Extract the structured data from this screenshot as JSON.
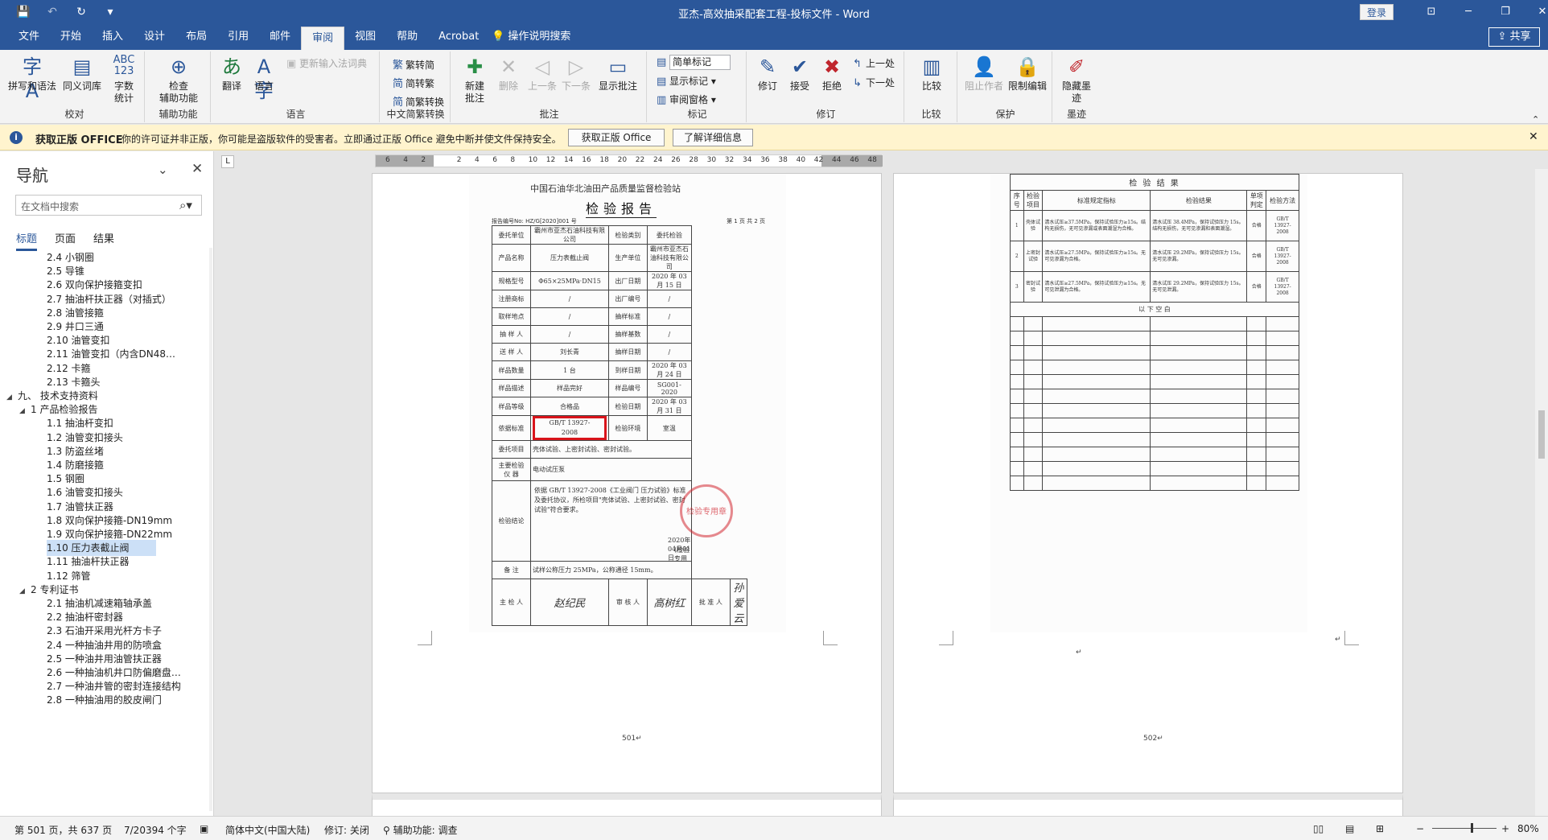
{
  "title_bar": {
    "title": "亚杰-高效抽采配套工程-投标文件  -  Word",
    "login": "登录",
    "qat": {
      "save": "💾",
      "undo": "↶",
      "redo": "↷",
      "refresh": "↻",
      "more": "▾"
    },
    "win": {
      "ribbon_opts": "⊡",
      "minimize": "─",
      "restore": "❐",
      "close": "✕"
    }
  },
  "tabs": [
    "文件",
    "开始",
    "插入",
    "设计",
    "布局",
    "引用",
    "邮件",
    "审阅",
    "视图",
    "帮助",
    "Acrobat"
  ],
  "tell_me": "操作说明搜索",
  "share": "共享",
  "ribbon": {
    "proofing": {
      "label": "校对",
      "spell": "拼写和语法",
      "thesaurus": "同义词库",
      "wordcount": "字数\n统计"
    },
    "accessibility": {
      "label": "辅助功能",
      "check": "检查\n辅助功能"
    },
    "language": {
      "label": "语言",
      "translate": "翻译",
      "language": "语言",
      "update_ime": "更新输入法词典"
    },
    "chinese": {
      "label": "中文简繁转换",
      "to_trad": "繁转简",
      "to_simp": "简转繁",
      "convert": "简繁转换"
    },
    "comments": {
      "label": "批注",
      "new": "新建\n批注",
      "delete": "删除",
      "prev": "上一条",
      "next": "下一条",
      "show": "显示批注"
    },
    "tracking": {
      "label": "标记",
      "markup_select": "简单标记",
      "show_markup": "显示标记",
      "review_pane": "审阅窗格"
    },
    "changes": {
      "label": "修订",
      "track": "修订",
      "accept": "接受",
      "reject": "拒绝",
      "prev": "上一处",
      "next": "下一处"
    },
    "compare": {
      "label": "比较",
      "compare": "比较"
    },
    "protect": {
      "label": "保护",
      "block": "阻止作者",
      "restrict": "限制编辑"
    },
    "ink": {
      "label": "墨迹",
      "hide": "隐藏墨\n迹"
    }
  },
  "message_bar": {
    "icon": "i",
    "title": "获取正版 OFFICE",
    "text": "你的许可证并非正版，你可能是盗版软件的受害者。立即通过正版 Office 避免中断并使文件保持安全。",
    "btn1": "获取正版 Office",
    "btn2": "了解详细信息",
    "close": "✕"
  },
  "nav": {
    "title": "导航",
    "search_placeholder": "在文档中搜索",
    "tabs": [
      "标题",
      "页面",
      "结果"
    ],
    "items": [
      {
        "text": "2.4 小钢圈",
        "level": 3
      },
      {
        "text": "2.5 导锥",
        "level": 3
      },
      {
        "text": "2.6 双向保护接箍变扣",
        "level": 3
      },
      {
        "text": "2.7 抽油杆扶正器（对插式）",
        "level": 3
      },
      {
        "text": "2.8 油管接箍",
        "level": 3
      },
      {
        "text": "2.9 井口三通",
        "level": 3
      },
      {
        "text": "2.10 油管变扣",
        "level": 3
      },
      {
        "text": "2.11 油管变扣（内含DN48…",
        "level": 3
      },
      {
        "text": "2.12 卡箍",
        "level": 3
      },
      {
        "text": "2.13 卡箍头",
        "level": 3
      },
      {
        "text": "九、 技术支持资料",
        "level": 1,
        "toggle": "◢"
      },
      {
        "text": "1 产品检验报告",
        "level": 2,
        "toggle": "◢"
      },
      {
        "text": "1.1 抽油杆变扣",
        "level": 3
      },
      {
        "text": "1.2 油管变扣接头",
        "level": 3
      },
      {
        "text": "1.3 防盗丝堵",
        "level": 3
      },
      {
        "text": "1.4 防磨接箍",
        "level": 3
      },
      {
        "text": "1.5 钢圈",
        "level": 3
      },
      {
        "text": "1.6 油管变扣接头",
        "level": 3
      },
      {
        "text": "1.7 油管扶正器",
        "level": 3
      },
      {
        "text": "1.8 双向保护接箍-DN19mm",
        "level": 3
      },
      {
        "text": "1.9 双向保护接箍-DN22mm",
        "level": 3
      },
      {
        "text": "1.10 压力表截止阀",
        "level": 3,
        "selected": true
      },
      {
        "text": "1.11 抽油杆扶正器",
        "level": 3
      },
      {
        "text": "1.12 筛管",
        "level": 3
      },
      {
        "text": "2 专利证书",
        "level": 2,
        "toggle": "◢"
      },
      {
        "text": "2.1 抽油机减速箱轴承盖",
        "level": 3
      },
      {
        "text": "2.2 抽油杆密封器",
        "level": 3
      },
      {
        "text": "2.3 石油开采用光杆方卡子",
        "level": 3
      },
      {
        "text": "2.4 一种抽油井用的防喷盒",
        "level": 3
      },
      {
        "text": "2.5 一种油井用油管扶正器",
        "level": 3
      },
      {
        "text": "2.6 一种抽油机井口防偏磨盘…",
        "level": 3
      },
      {
        "text": "2.7 一种油井管的密封连接结构",
        "level": 3
      },
      {
        "text": "2.8 一种抽油用的胶皮闸门",
        "level": 3
      }
    ]
  },
  "ruler": {
    "ticks": [
      "6",
      "4",
      "2",
      "",
      "2",
      "4",
      "6",
      "8",
      "10",
      "12",
      "14",
      "16",
      "18",
      "20",
      "22",
      "24",
      "26",
      "28",
      "30",
      "32",
      "34",
      "36",
      "38",
      "40",
      "42",
      "44",
      "46",
      "48"
    ],
    "corner": "L"
  },
  "page1": {
    "number": "501↵",
    "institute": "中国石油华北油田产品质量监督检验站",
    "report_title": "检验报告",
    "report_no": "报告编号No: HZ/G[2020]001 号",
    "page_of": "第 1 页 共 2 页",
    "rows": [
      [
        "委托单位",
        "霸州市亚杰石油科技有限公司",
        "检验类别",
        "委托检验"
      ],
      [
        "产品名称",
        "压力表截止阀",
        "生产单位",
        "霸州市亚杰石油科技有限公司"
      ],
      [
        "规格型号",
        "Φ65×25MPa·DN15",
        "出厂日期",
        "2020 年 03 月 15 日"
      ],
      [
        "注册商标",
        "/",
        "出厂编号",
        "/"
      ],
      [
        "取样地点",
        "/",
        "抽样标准",
        "/"
      ],
      [
        "抽 样 人",
        "/",
        "抽样基数",
        "/"
      ],
      [
        "送 样 人",
        "刘长青",
        "抽样日期",
        "/"
      ],
      [
        "样品数量",
        "1 台",
        "到样日期",
        "2020 年 03 月 24 日"
      ],
      [
        "样品描述",
        "样品完好",
        "样品编号",
        "SG001-2020"
      ],
      [
        "样品等级",
        "合格品",
        "检验日期",
        "2020 年 03 月 31 日"
      ],
      [
        "依据标准",
        "GB/T 13927-2008",
        "检验环境",
        "室温"
      ]
    ],
    "item_label": "委托项目",
    "item_value": "壳体试验、上密封试验、密封试验。",
    "instr_label": "主要检验\n仪  器",
    "instr_value": "电动试压泵",
    "concl_label": "检验结论",
    "concl_text": "依据 GB/T 13927-2008《工业阀门 压力试验》标准及委托协议，所检项目\"壳体试验、上密封试验、密封试验\"符合要求。",
    "concl_date": "2020年04月01日",
    "concl_sign": "(检验专用章)",
    "stamp_text": "检验专用章",
    "remark_label": "备    注",
    "remark_value": "试样公称压力 25MPa，公称通径 15mm。",
    "sign_labels": [
      "主 检 人",
      "审 核 人",
      "批 准 人"
    ],
    "signatures": [
      "赵纪民",
      "高树红",
      "孙爱云"
    ]
  },
  "page2": {
    "number": "502↵",
    "heading": "检  验  结  果",
    "cols": [
      "序号",
      "检验项目",
      "标准规定指标",
      "检验结果",
      "单项判定",
      "检验方法"
    ],
    "rows": [
      [
        "1",
        "壳体试验",
        "清水试压≥37.5MPa，保持试验压力≥15s。结构无损伤，无可见渗漏或表面潮湿为合格。",
        "清水试压 38.4MPa，保持试验压力 15s。结构无损伤，无可见渗漏和表面潮湿。",
        "合格",
        "GB/T 13927-2008"
      ],
      [
        "2",
        "上密封试验",
        "清水试压≥27.5MPa，保持试验压力≥15s。无可见渗漏为合格。",
        "清水试压 29.2MPa，保持试验压力 15s。无可见渗漏。",
        "合格",
        "GB/T 13927-2008"
      ],
      [
        "3",
        "密封试验",
        "清水试压≥27.5MPa，保持试验压力≥15s。无可见泄漏为合格。",
        "清水试压 29.2MPa，保持试验压力 15s。无可见泄漏。",
        "合格",
        "GB/T 13927-2008"
      ]
    ],
    "blank_text": "以  下  空  白",
    "para_mark": "↵"
  },
  "status": {
    "page": "第 501 页，共 637 页",
    "words": "7/20394 个字",
    "lang": "简体中文(中国大陆)",
    "track": "修订: 关闭",
    "access": "辅助功能: 调查",
    "zoom": "80%",
    "zoom_level": 0.8
  }
}
